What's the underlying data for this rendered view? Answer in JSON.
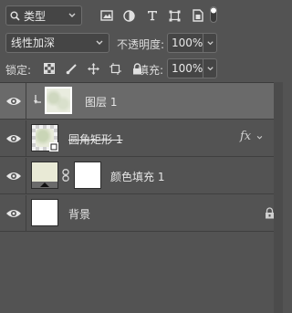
{
  "toolbar": {
    "filter_kind": "类型",
    "filter_icons": [
      "image-filter-icon",
      "adjustment-filter-icon",
      "type-filter-icon",
      "shape-filter-icon",
      "smart-object-filter-icon"
    ]
  },
  "blend": {
    "mode": "线性加深",
    "opacity_label": "不透明度:",
    "opacity_value": "100%"
  },
  "lock": {
    "label": "锁定:",
    "fill_label": "填充:",
    "fill_value": "100%"
  },
  "layers": [
    {
      "name": "图层 1",
      "clipped": true,
      "selected": true
    },
    {
      "name": "圆角矩形 1",
      "fx": "fx",
      "strikethrough": true
    },
    {
      "name": "颜色填充 1",
      "linked_mask": true
    },
    {
      "name": "背景",
      "locked": true
    }
  ],
  "colors": {
    "panel": "#535353",
    "selected": "#6a6a6a",
    "fill_thumb": "#e9ead6"
  }
}
